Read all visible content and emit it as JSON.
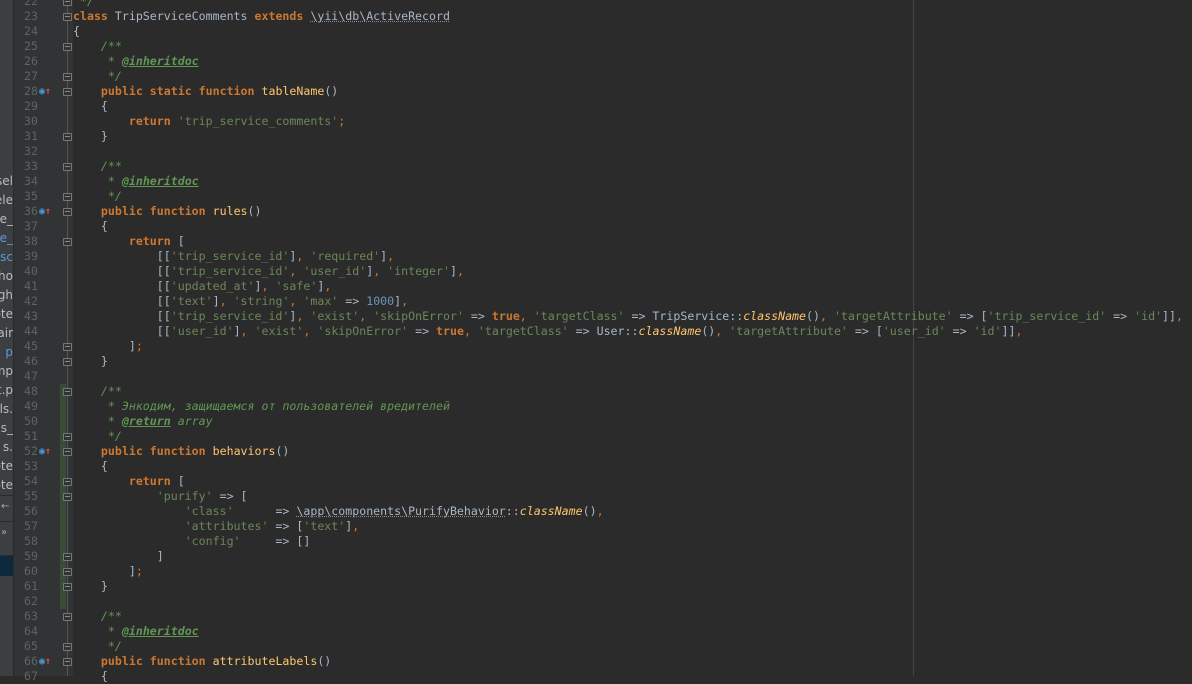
{
  "project_panel": {
    "fragments": [
      {
        "text": "sel",
        "highlight": false
      },
      {
        "text": "ele",
        "highlight": false
      },
      {
        "text": "e_",
        "highlight": false
      },
      {
        "text": "e_",
        "highlight": true
      },
      {
        "text": "esc",
        "highlight": true
      },
      {
        "text": "ho",
        "highlight": false
      },
      {
        "text": "gh",
        "highlight": false
      },
      {
        "text": "ote",
        "highlight": false
      },
      {
        "text": "air",
        "highlight": false
      },
      {
        "text": "p",
        "highlight": true
      },
      {
        "text": "mp",
        "highlight": false
      },
      {
        "text": "t.p",
        "highlight": false
      },
      {
        "text": "els.",
        "highlight": false
      },
      {
        "text": "els_",
        "highlight": false
      },
      {
        "text": "s.",
        "highlight": false
      },
      {
        "text": "ote",
        "highlight": false
      },
      {
        "text": "ote",
        "highlight": false
      }
    ],
    "icons": [
      "arrow-left-icon",
      "double-chevron-right-icon"
    ]
  },
  "editor": {
    "first_line": 22,
    "override_lines": [
      28,
      36,
      52,
      66
    ],
    "fold_lines": [
      22,
      23,
      25,
      27,
      28,
      31,
      33,
      35,
      36,
      38,
      45,
      46,
      48,
      51,
      52,
      54,
      55,
      59,
      60,
      61,
      63,
      65,
      66
    ],
    "changed_range": [
      48,
      62
    ],
    "colors": {
      "background": "#2b2b2b",
      "keyword": "#cc7832",
      "string": "#6a8759",
      "doc": "#629755",
      "number": "#6897bb",
      "function": "#ffc66d"
    },
    "lines": [
      " */",
      "class TripServiceComments extends \\yii\\db\\ActiveRecord",
      "{",
      "    /**",
      "     * @inheritdoc",
      "     */",
      "    public static function tableName()",
      "    {",
      "        return 'trip_service_comments';",
      "    }",
      "",
      "    /**",
      "     * @inheritdoc",
      "     */",
      "    public function rules()",
      "    {",
      "        return [",
      "            [['trip_service_id'], 'required'],",
      "            [['trip_service_id', 'user_id'], 'integer'],",
      "            [['updated_at'], 'safe'],",
      "            [['text'], 'string', 'max' => 1000],",
      "            [['trip_service_id'], 'exist', 'skipOnError' => true, 'targetClass' => TripService::className(), 'targetAttribute' => ['trip_service_id' => 'id']],",
      "            [['user_id'], 'exist', 'skipOnError' => true, 'targetClass' => User::className(), 'targetAttribute' => ['user_id' => 'id']],",
      "        ];",
      "    }",
      "",
      "    /**",
      "     * Энкодим, защищаемся от пользователей вредителей",
      "     * @return array",
      "     */",
      "    public function behaviors()",
      "    {",
      "        return [",
      "            'purify' => [",
      "                'class'      => \\app\\components\\PurifyBehavior::className(),",
      "                'attributes' => ['text'],",
      "                'config'     => []",
      "            ]",
      "        ];",
      "    }",
      "",
      "    /**",
      "     * @inheritdoc",
      "     */",
      "    public function attributeLabels()",
      "    {"
    ]
  }
}
